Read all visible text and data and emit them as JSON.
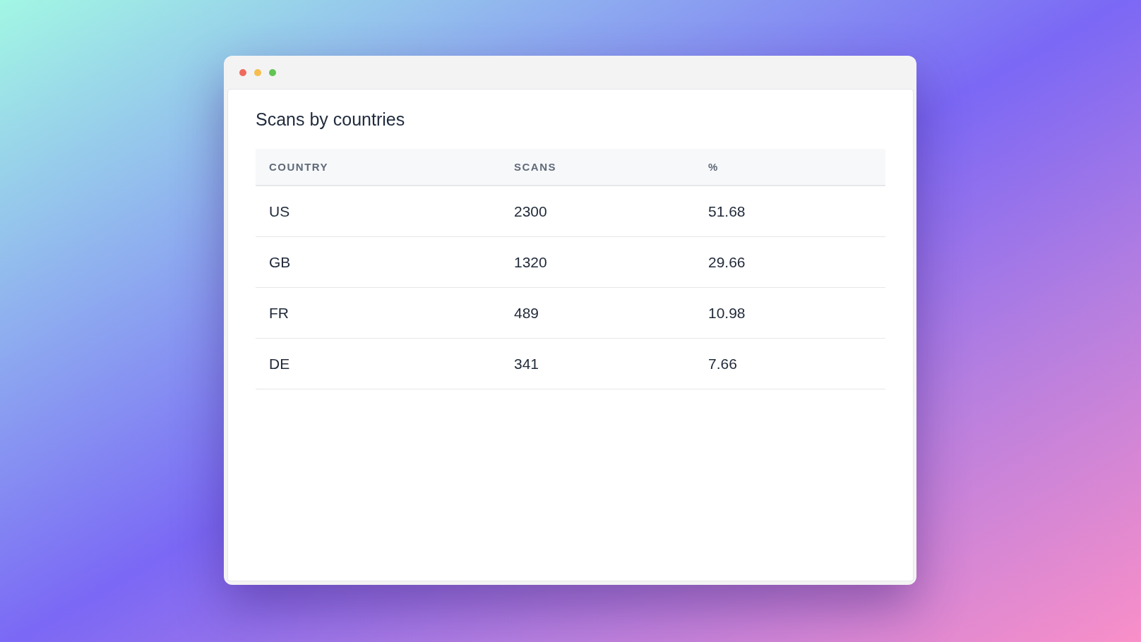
{
  "card": {
    "title": "Scans by countries"
  },
  "table": {
    "columns": [
      "COUNTRY",
      "SCANS",
      "%"
    ],
    "rows": [
      [
        "US",
        "2300",
        "51.68"
      ],
      [
        "GB",
        "1320",
        "29.66"
      ],
      [
        "FR",
        "489",
        "10.98"
      ],
      [
        "DE",
        "341",
        "7.66"
      ]
    ]
  }
}
